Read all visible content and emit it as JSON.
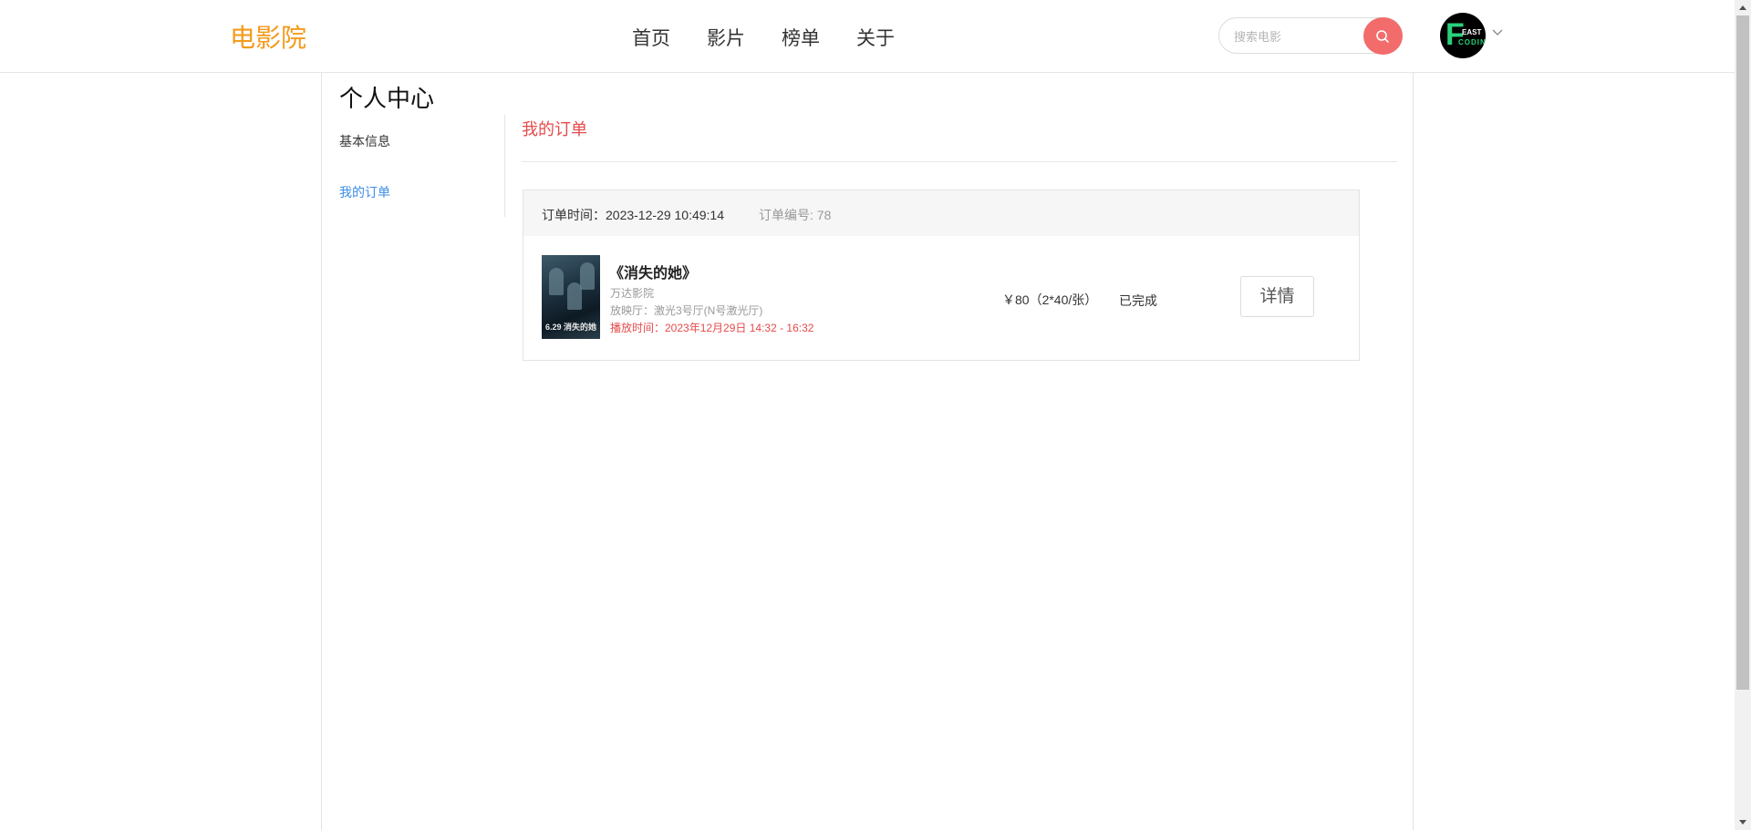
{
  "header": {
    "logo": "电影院",
    "nav": [
      "首页",
      "影片",
      "榜单",
      "关于"
    ],
    "search_placeholder": "搜索电影",
    "avatar": {
      "big": "F",
      "east": "EAST",
      "coding": "CODING"
    }
  },
  "sidebar": {
    "title": "个人中心",
    "items": [
      "基本信息",
      "我的订单"
    ]
  },
  "main": {
    "section_title": "我的订单",
    "orders": [
      {
        "order_time_label": "订单时间：2023-12-29 10:49:14",
        "order_no_label": "订单编号: 78",
        "poster_text": "6.29 消失的她",
        "movie_name": "《消失的她》",
        "cinema": "万达影院",
        "hall": "放映厅：激光3号厅(N号激光厅)",
        "showtime": "播放时间：2023年12月29日 14:32 - 16:32",
        "price": "￥80（2*40/张）",
        "status": "已完成",
        "detail_label": "详情"
      }
    ]
  },
  "colors": {
    "logo": "#f39a1b",
    "accent_red": "#e54b4b",
    "search_button": "#f36c6c",
    "active_link": "#3b8ee8"
  }
}
